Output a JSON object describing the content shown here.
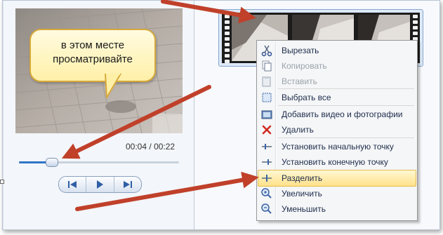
{
  "window": {
    "accent_color": "#2f74c7",
    "arrow_color": "#c0402a"
  },
  "preview": {
    "callout_line1": "в этом месте",
    "callout_line2": "просматривайте",
    "time_current": "00:04",
    "time_separator": "/",
    "time_total": "00:22",
    "seek_position_fraction": 0.2
  },
  "playback": {
    "prev_icon": "step-back-icon",
    "play_icon": "play-icon",
    "next_icon": "step-forward-icon"
  },
  "context_menu": {
    "items": [
      {
        "label": "Вырезать",
        "icon": "scissors-icon",
        "enabled": true
      },
      {
        "label": "Копировать",
        "icon": "copy-icon",
        "enabled": false
      },
      {
        "label": "Вставить",
        "icon": "paste-icon",
        "enabled": false
      },
      {
        "label": "Выбрать все",
        "icon": "select-all-icon",
        "enabled": true
      },
      {
        "label": "Добавить видео и фотографии",
        "icon": "add-media-icon",
        "enabled": true
      },
      {
        "label": "Удалить",
        "icon": "delete-icon",
        "enabled": true
      },
      {
        "label": "Установить начальную точку",
        "icon": "set-start-point-icon",
        "enabled": true
      },
      {
        "label": "Установить конечную точку",
        "icon": "set-end-point-icon",
        "enabled": true
      },
      {
        "label": "Разделить",
        "icon": "split-icon",
        "enabled": true,
        "highlighted": true
      },
      {
        "label": "Увеличить",
        "icon": "zoom-in-icon",
        "enabled": true
      },
      {
        "label": "Уменьшить",
        "icon": "zoom-out-icon",
        "enabled": true
      }
    ]
  }
}
